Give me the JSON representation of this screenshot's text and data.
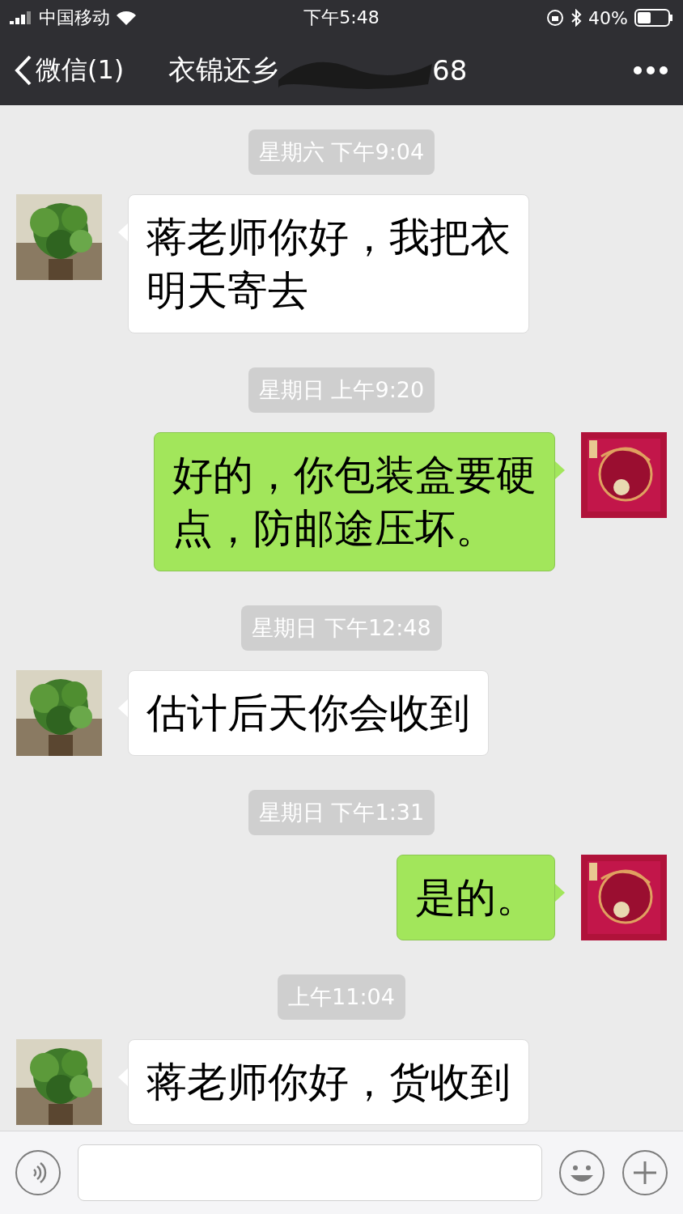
{
  "status_bar": {
    "carrier": "中国移动",
    "time": "下午5:48",
    "battery": "40%"
  },
  "nav": {
    "back": "微信(1)",
    "title": "衣锦还乡",
    "title_end": "68"
  },
  "messages": [
    {
      "kind": "time",
      "text": "星期六 下午9:04"
    },
    {
      "kind": "bubble",
      "outgoing": false,
      "text": "蒋老师你好，我把衣明天寄去"
    },
    {
      "kind": "time",
      "text": "星期日 上午9:20"
    },
    {
      "kind": "bubble",
      "outgoing": true,
      "text": "好的，你包装盒要硬点，防邮途压坏。"
    },
    {
      "kind": "time",
      "text": "星期日 下午12:48"
    },
    {
      "kind": "bubble",
      "outgoing": false,
      "text": "估计后天你会收到"
    },
    {
      "kind": "time",
      "text": "星期日 下午1:31"
    },
    {
      "kind": "bubble",
      "outgoing": true,
      "text": "是的。"
    },
    {
      "kind": "time",
      "text": "上午11:04"
    },
    {
      "kind": "bubble",
      "outgoing": false,
      "text": "蒋老师你好，货收到"
    }
  ]
}
